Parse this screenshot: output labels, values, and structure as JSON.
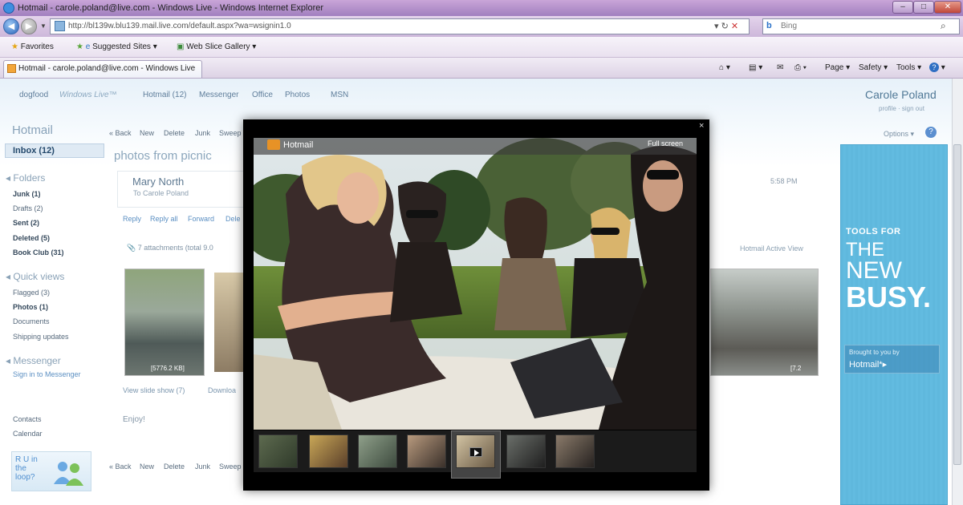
{
  "browser": {
    "window_title": "Hotmail - carole.poland@live.com - Windows Live - Windows Internet Explorer",
    "address": "http://bl139w.blu139.mail.live.com/default.aspx?wa=wsignin1.0",
    "search_placeholder": "Bing",
    "favorites": {
      "favorites_label": "Favorites",
      "suggested_sites": "Suggested Sites ▾",
      "web_slice_gallery": "Web Slice Gallery ▾"
    },
    "tab_title": "Hotmail - carole.poland@live.com - Windows Live",
    "command_bar": {
      "page": "Page ▾",
      "safety": "Safety ▾",
      "tools": "Tools ▾"
    }
  },
  "topnav": {
    "dogfood": "dogfood",
    "windows_live": "Windows Live™",
    "links": [
      "Hotmail (12)",
      "Messenger",
      "Office",
      "Photos",
      "MSN"
    ],
    "user_name": "Carole Poland",
    "user_links": "profile · sign out"
  },
  "sidebar": {
    "title": "Hotmail",
    "inbox": "Inbox (12)",
    "folders_header": "Folders",
    "folders": [
      {
        "label": "Junk (1)",
        "bold": true
      },
      {
        "label": "Drafts (2)",
        "bold": false
      },
      {
        "label": "Sent (2)",
        "bold": true
      },
      {
        "label": "Deleted (5)",
        "bold": true
      },
      {
        "label": "Book Club (31)",
        "bold": true
      }
    ],
    "quickviews_header": "Quick views",
    "quickviews": [
      {
        "label": "Flagged (3)",
        "bold": false
      },
      {
        "label": "Photos (1)",
        "bold": true
      },
      {
        "label": "Documents",
        "bold": false
      },
      {
        "label": "Shipping updates",
        "bold": false
      }
    ],
    "messenger_header": "Messenger",
    "messenger_link": "Sign in to Messenger",
    "bottom_links": [
      "Contacts",
      "Calendar"
    ],
    "promo": "R U in the loop?"
  },
  "toolbar": {
    "items": [
      "« Back",
      "New",
      "Delete",
      "Junk",
      "Sweep"
    ]
  },
  "message": {
    "subject": "photos from picnic",
    "sender": "Mary North",
    "to": "To Carole Poland",
    "time": "5:58 PM",
    "actions": [
      "Reply",
      "Reply all",
      "Forward",
      "Dele"
    ],
    "attachments": "7 attachments (total 9.0",
    "thumb_size": "[5776.2 KB]",
    "thumb_size_right": "[7.2",
    "slideshow": "View slide show (7)",
    "download": "Downloa",
    "body": "Enjoy!",
    "active_view": "Hotmail Active View",
    "options": "Options ▾"
  },
  "overlay": {
    "brand": "Hotmail",
    "full_screen": "Full screen",
    "close": "×",
    "thumbnail_count": 7,
    "selected_thumbnail_index": 4
  },
  "ad": {
    "line1": "TOOLS FOR",
    "line2": "THE",
    "line3": "NEW",
    "line4": "BUSY.",
    "brought": "Brought to you by",
    "brand": "Hotmail*▸"
  },
  "colors": {
    "ie_titlebar": "#a17fbf",
    "ad_blue": "#5fb8dd",
    "hotmail_orange": "#e79226"
  }
}
